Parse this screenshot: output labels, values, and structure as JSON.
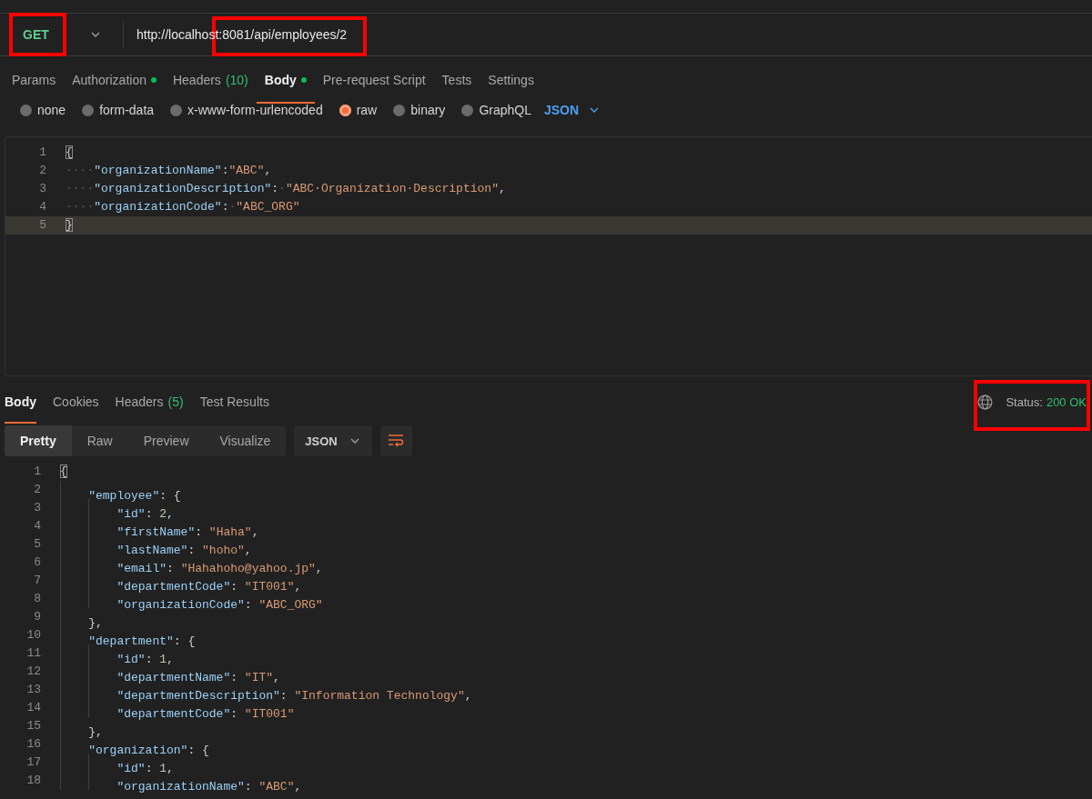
{
  "request": {
    "method": "GET",
    "method_highlighted": true,
    "url": "http://localhost:8081/api/employees/2",
    "url_highlighted": true
  },
  "request_tabs": [
    {
      "label": "Params",
      "selected": false
    },
    {
      "label": "Authorization",
      "dot": true,
      "selected": false
    },
    {
      "label": "Headers",
      "count": "(10)",
      "selected": false
    },
    {
      "label": "Body",
      "dot": true,
      "selected": true
    },
    {
      "label": "Pre-request Script",
      "selected": false
    },
    {
      "label": "Tests",
      "selected": false
    },
    {
      "label": "Settings",
      "selected": false
    }
  ],
  "body_types": [
    {
      "label": "none",
      "selected": false
    },
    {
      "label": "form-data",
      "selected": false
    },
    {
      "label": "x-www-form-urlencoded",
      "selected": false
    },
    {
      "label": "raw",
      "selected": true
    },
    {
      "label": "binary",
      "selected": false
    },
    {
      "label": "GraphQL",
      "selected": false
    }
  ],
  "body_format": "JSON",
  "request_body": {
    "lines": [
      {
        "number": "1",
        "current": false,
        "tokens": [
          {
            "kind": "brace_match",
            "text": "{"
          }
        ]
      },
      {
        "number": "2",
        "current": false,
        "tokens": [
          {
            "kind": "space",
            "text": "····"
          },
          {
            "kind": "key",
            "text": "\"organizationName\""
          },
          {
            "kind": "punct",
            "text": ":"
          },
          {
            "kind": "string",
            "text": "\"ABC\""
          },
          {
            "kind": "punct",
            "text": ","
          }
        ]
      },
      {
        "number": "3",
        "current": false,
        "tokens": [
          {
            "kind": "space",
            "text": "····"
          },
          {
            "kind": "key",
            "text": "\"organizationDescription\""
          },
          {
            "kind": "punct",
            "text": ":"
          },
          {
            "kind": "space",
            "text": "·"
          },
          {
            "kind": "string",
            "text": "\"ABC·Organization·Description\""
          },
          {
            "kind": "punct",
            "text": ","
          }
        ]
      },
      {
        "number": "4",
        "current": false,
        "tokens": [
          {
            "kind": "space",
            "text": "····"
          },
          {
            "kind": "key",
            "text": "\"organizationCode\""
          },
          {
            "kind": "punct",
            "text": ":"
          },
          {
            "kind": "space",
            "text": "·"
          },
          {
            "kind": "string",
            "text": "\"ABC_ORG\""
          }
        ]
      },
      {
        "number": "5",
        "current": true,
        "tokens": [
          {
            "kind": "brace_match",
            "text": "}"
          }
        ]
      }
    ]
  },
  "response_tabs": [
    {
      "label": "Body",
      "selected": true
    },
    {
      "label": "Cookies",
      "selected": false
    },
    {
      "label": "Headers",
      "count": "(5)",
      "selected": false
    },
    {
      "label": "Test Results",
      "selected": false
    }
  ],
  "status": {
    "label": "Status:",
    "value": "200 OK",
    "highlighted": true
  },
  "view_modes": [
    {
      "label": "Pretty",
      "selected": true
    },
    {
      "label": "Raw",
      "selected": false
    },
    {
      "label": "Preview",
      "selected": false
    },
    {
      "label": "Visualize",
      "selected": false
    }
  ],
  "response_format": "JSON",
  "response_body": {
    "lines": [
      {
        "number": "1",
        "tokens": [
          {
            "kind": "brace_match",
            "text": "{"
          }
        ]
      },
      {
        "number": "2",
        "tokens": [
          {
            "kind": "indent"
          },
          {
            "kind": "key",
            "text": "\"employee\""
          },
          {
            "kind": "punct",
            "text": ": {"
          }
        ]
      },
      {
        "number": "3",
        "tokens": [
          {
            "kind": "indent"
          },
          {
            "kind": "indent"
          },
          {
            "kind": "key",
            "text": "\"id\""
          },
          {
            "kind": "punct",
            "text": ": "
          },
          {
            "kind": "number",
            "text": "2"
          },
          {
            "kind": "punct",
            "text": ","
          }
        ]
      },
      {
        "number": "4",
        "tokens": [
          {
            "kind": "indent"
          },
          {
            "kind": "indent"
          },
          {
            "kind": "key",
            "text": "\"firstName\""
          },
          {
            "kind": "punct",
            "text": ": "
          },
          {
            "kind": "string",
            "text": "\"Haha\""
          },
          {
            "kind": "punct",
            "text": ","
          }
        ]
      },
      {
        "number": "5",
        "tokens": [
          {
            "kind": "indent"
          },
          {
            "kind": "indent"
          },
          {
            "kind": "key",
            "text": "\"lastName\""
          },
          {
            "kind": "punct",
            "text": ": "
          },
          {
            "kind": "string",
            "text": "\"hoho\""
          },
          {
            "kind": "punct",
            "text": ","
          }
        ]
      },
      {
        "number": "6",
        "tokens": [
          {
            "kind": "indent"
          },
          {
            "kind": "indent"
          },
          {
            "kind": "key",
            "text": "\"email\""
          },
          {
            "kind": "punct",
            "text": ": "
          },
          {
            "kind": "string",
            "text": "\"Hahahoho@yahoo.jp\""
          },
          {
            "kind": "punct",
            "text": ","
          }
        ]
      },
      {
        "number": "7",
        "tokens": [
          {
            "kind": "indent"
          },
          {
            "kind": "indent"
          },
          {
            "kind": "key",
            "text": "\"departmentCode\""
          },
          {
            "kind": "punct",
            "text": ": "
          },
          {
            "kind": "string",
            "text": "\"IT001\""
          },
          {
            "kind": "punct",
            "text": ","
          }
        ]
      },
      {
        "number": "8",
        "tokens": [
          {
            "kind": "indent"
          },
          {
            "kind": "indent"
          },
          {
            "kind": "key",
            "text": "\"organizationCode\""
          },
          {
            "kind": "punct",
            "text": ": "
          },
          {
            "kind": "string",
            "text": "\"ABC_ORG\""
          }
        ]
      },
      {
        "number": "9",
        "tokens": [
          {
            "kind": "indent"
          },
          {
            "kind": "punct",
            "text": "},"
          }
        ]
      },
      {
        "number": "10",
        "tokens": [
          {
            "kind": "indent"
          },
          {
            "kind": "key",
            "text": "\"department\""
          },
          {
            "kind": "punct",
            "text": ": {"
          }
        ]
      },
      {
        "number": "11",
        "tokens": [
          {
            "kind": "indent"
          },
          {
            "kind": "indent"
          },
          {
            "kind": "key",
            "text": "\"id\""
          },
          {
            "kind": "punct",
            "text": ": "
          },
          {
            "kind": "number",
            "text": "1"
          },
          {
            "kind": "punct",
            "text": ","
          }
        ]
      },
      {
        "number": "12",
        "tokens": [
          {
            "kind": "indent"
          },
          {
            "kind": "indent"
          },
          {
            "kind": "key",
            "text": "\"departmentName\""
          },
          {
            "kind": "punct",
            "text": ": "
          },
          {
            "kind": "string",
            "text": "\"IT\""
          },
          {
            "kind": "punct",
            "text": ","
          }
        ]
      },
      {
        "number": "13",
        "tokens": [
          {
            "kind": "indent"
          },
          {
            "kind": "indent"
          },
          {
            "kind": "key",
            "text": "\"departmentDescription\""
          },
          {
            "kind": "punct",
            "text": ": "
          },
          {
            "kind": "string",
            "text": "\"Information Technology\""
          },
          {
            "kind": "punct",
            "text": ","
          }
        ]
      },
      {
        "number": "14",
        "tokens": [
          {
            "kind": "indent"
          },
          {
            "kind": "indent"
          },
          {
            "kind": "key",
            "text": "\"departmentCode\""
          },
          {
            "kind": "punct",
            "text": ": "
          },
          {
            "kind": "string",
            "text": "\"IT001\""
          }
        ]
      },
      {
        "number": "15",
        "tokens": [
          {
            "kind": "indent"
          },
          {
            "kind": "punct",
            "text": "},"
          }
        ]
      },
      {
        "number": "16",
        "tokens": [
          {
            "kind": "indent"
          },
          {
            "kind": "key",
            "text": "\"organization\""
          },
          {
            "kind": "punct",
            "text": ": {"
          }
        ]
      },
      {
        "number": "17",
        "tokens": [
          {
            "kind": "indent"
          },
          {
            "kind": "indent"
          },
          {
            "kind": "key",
            "text": "\"id\""
          },
          {
            "kind": "punct",
            "text": ": "
          },
          {
            "kind": "number",
            "text": "1"
          },
          {
            "kind": "punct",
            "text": ","
          }
        ]
      },
      {
        "number": "18",
        "tokens": [
          {
            "kind": "indent"
          },
          {
            "kind": "indent"
          },
          {
            "kind": "key",
            "text": "\"organizationName\""
          },
          {
            "kind": "punct",
            "text": ": "
          },
          {
            "kind": "string",
            "text": "\"ABC\""
          },
          {
            "kind": "punct",
            "text": ","
          }
        ]
      }
    ]
  }
}
